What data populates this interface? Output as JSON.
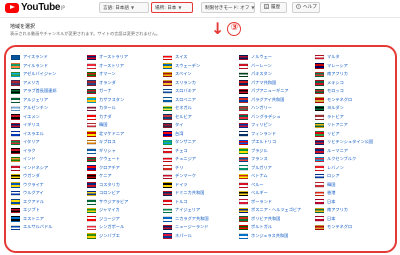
{
  "header": {
    "logo_text": "YouTube",
    "logo_suffix": "JP",
    "language_label": "言語: 日本語",
    "location_label": "場所: 日本",
    "restricted_label": "制限付きモード: オフ",
    "history_label": "履歴",
    "help_label": "ヘルプ"
  },
  "page": {
    "heading": "地域を選択",
    "subtext": "表示される動画やチャンネルが変更されます。サイトの言語は変更されません。",
    "annotation_number": "③",
    "accent_color": "#e53935"
  },
  "columns": [
    [
      {
        "name": "アイスランド",
        "c": [
          "#02529c",
          "#02529c"
        ]
      },
      {
        "name": "アイルランド",
        "c": [
          "#169b62",
          "#ff883e"
        ]
      },
      {
        "name": "アゼルバイジャン",
        "c": [
          "#00b5e2",
          "#3f9c35"
        ]
      },
      {
        "name": "アメリカ",
        "c": [
          "#b22234",
          "#3c3b6e"
        ]
      },
      {
        "name": "アラブ首長国連邦",
        "c": [
          "#00732f",
          "#000000"
        ]
      },
      {
        "name": "アルジェリア",
        "c": [
          "#006233",
          "#ffffff"
        ]
      },
      {
        "name": "アルゼンチン",
        "c": [
          "#74acdf",
          "#ffffff"
        ]
      },
      {
        "name": "イエメン",
        "c": [
          "#ce1126",
          "#000000"
        ]
      },
      {
        "name": "イギリス",
        "c": [
          "#012169",
          "#c8102e"
        ]
      },
      {
        "name": "イスラエル",
        "c": [
          "#ffffff",
          "#0038b8"
        ]
      },
      {
        "name": "イタリア",
        "c": [
          "#009246",
          "#ce2b37"
        ]
      },
      {
        "name": "イラク",
        "c": [
          "#ce1126",
          "#000000"
        ]
      },
      {
        "name": "インド",
        "c": [
          "#ff9933",
          "#138808"
        ]
      },
      {
        "name": "インドネシア",
        "c": [
          "#ce1126",
          "#ffffff"
        ]
      },
      {
        "name": "ウガンダ",
        "c": [
          "#000000",
          "#fcdc04"
        ]
      },
      {
        "name": "ウクライナ",
        "c": [
          "#0057b7",
          "#ffd700"
        ]
      },
      {
        "name": "ウルグアイ",
        "c": [
          "#ffffff",
          "#0038a8"
        ]
      },
      {
        "name": "エクアドル",
        "c": [
          "#ffdd00",
          "#034ea2"
        ]
      },
      {
        "name": "エジプト",
        "c": [
          "#ce1126",
          "#000000"
        ]
      },
      {
        "name": "エストニア",
        "c": [
          "#0072ce",
          "#000000"
        ]
      },
      {
        "name": "エルサルバドル",
        "c": [
          "#0047ab",
          "#ffffff"
        ]
      }
    ],
    [
      {
        "name": "オーストラリア",
        "c": [
          "#012169",
          "#e4002b"
        ]
      },
      {
        "name": "オーストリア",
        "c": [
          "#ed2939",
          "#ffffff"
        ]
      },
      {
        "name": "オマーン",
        "c": [
          "#db161b",
          "#008000"
        ]
      },
      {
        "name": "オランダ",
        "c": [
          "#ae1c28",
          "#21468b"
        ]
      },
      {
        "name": "ガーナ",
        "c": [
          "#ce1126",
          "#006b3f"
        ]
      },
      {
        "name": "カザフスタン",
        "c": [
          "#00afca",
          "#fec50c"
        ]
      },
      {
        "name": "カタール",
        "c": [
          "#8a1538",
          "#ffffff"
        ]
      },
      {
        "name": "カナダ",
        "c": [
          "#ff0000",
          "#ffffff"
        ]
      },
      {
        "name": "韓国",
        "c": [
          "#ffffff",
          "#cd2e3a"
        ]
      },
      {
        "name": "北マケドニア",
        "c": [
          "#d20000",
          "#ffe600"
        ]
      },
      {
        "name": "キプロス",
        "c": [
          "#ffffff",
          "#d57800"
        ]
      },
      {
        "name": "ギリシャ",
        "c": [
          "#0d5eaf",
          "#ffffff"
        ]
      },
      {
        "name": "クウェート",
        "c": [
          "#007a3d",
          "#ce1126"
        ]
      },
      {
        "name": "クロアチア",
        "c": [
          "#ff0000",
          "#171796"
        ]
      },
      {
        "name": "ケニア",
        "c": [
          "#000000",
          "#bb0000"
        ]
      },
      {
        "name": "コスタリカ",
        "c": [
          "#002b7f",
          "#ce1126"
        ]
      },
      {
        "name": "コロンビア",
        "c": [
          "#fcd116",
          "#003893"
        ]
      },
      {
        "name": "サウジアラビア",
        "c": [
          "#006c35",
          "#ffffff"
        ]
      },
      {
        "name": "ジャマイカ",
        "c": [
          "#009b3a",
          "#fed100"
        ]
      },
      {
        "name": "ジョージア",
        "c": [
          "#ffffff",
          "#ff0000"
        ]
      },
      {
        "name": "シンガポール",
        "c": [
          "#ef3340",
          "#ffffff"
        ]
      },
      {
        "name": "ジンバブエ",
        "c": [
          "#319208",
          "#ffd200"
        ]
      }
    ],
    [
      {
        "name": "スイス",
        "c": [
          "#ff0000",
          "#ffffff"
        ]
      },
      {
        "name": "スウェーデン",
        "c": [
          "#006aa7",
          "#fecc00"
        ]
      },
      {
        "name": "スペイン",
        "c": [
          "#aa151b",
          "#f1bf00"
        ]
      },
      {
        "name": "スリランカ",
        "c": [
          "#8d153a",
          "#ffbe29"
        ]
      },
      {
        "name": "スロバキア",
        "c": [
          "#ffffff",
          "#0b4ea2"
        ]
      },
      {
        "name": "スロベニア",
        "c": [
          "#ffffff",
          "#005da4"
        ]
      },
      {
        "name": "セネガル",
        "c": [
          "#00853f",
          "#fdef42"
        ]
      },
      {
        "name": "セルビア",
        "c": [
          "#c6363c",
          "#0c4076"
        ]
      },
      {
        "name": "タイ",
        "c": [
          "#a51931",
          "#2d2a4a"
        ]
      },
      {
        "name": "台湾",
        "c": [
          "#fe0000",
          "#000095"
        ]
      },
      {
        "name": "タンザニア",
        "c": [
          "#1eb53a",
          "#00a3dd"
        ]
      },
      {
        "name": "チェコ",
        "c": [
          "#ffffff",
          "#d7141a"
        ]
      },
      {
        "name": "チュニジア",
        "c": [
          "#e70013",
          "#ffffff"
        ]
      },
      {
        "name": "チリ",
        "c": [
          "#ffffff",
          "#d52b1e"
        ]
      },
      {
        "name": "デンマーク",
        "c": [
          "#c8102e",
          "#ffffff"
        ]
      },
      {
        "name": "ドイツ",
        "c": [
          "#000000",
          "#ffce00"
        ]
      },
      {
        "name": "ドミニカ共和国",
        "c": [
          "#002d62",
          "#ce1126"
        ]
      },
      {
        "name": "トルコ",
        "c": [
          "#e30a17",
          "#ffffff"
        ]
      },
      {
        "name": "ナイジェリア",
        "c": [
          "#008751",
          "#ffffff"
        ]
      },
      {
        "name": "ニカラグア共和国",
        "c": [
          "#0067c6",
          "#ffffff"
        ]
      },
      {
        "name": "ニュージーランド",
        "c": [
          "#012169",
          "#c8102e"
        ]
      },
      {
        "name": "ネパール",
        "c": [
          "#dc143c",
          "#003893"
        ]
      }
    ],
    [
      {
        "name": "ノルウェー",
        "c": [
          "#ba0c2f",
          "#00205b"
        ]
      },
      {
        "name": "バーレーン",
        "c": [
          "#ce1126",
          "#ffffff"
        ]
      },
      {
        "name": "パキスタン",
        "c": [
          "#01411c",
          "#ffffff"
        ]
      },
      {
        "name": "パナマ共和国",
        "c": [
          "#da121a",
          "#072357"
        ]
      },
      {
        "name": "パプアニューギニア",
        "c": [
          "#000000",
          "#ce1126"
        ]
      },
      {
        "name": "パラグアイ共和国",
        "c": [
          "#d52b1e",
          "#0038a8"
        ]
      },
      {
        "name": "ハンガリー",
        "c": [
          "#ce2939",
          "#477050"
        ]
      },
      {
        "name": "バングラデシュ",
        "c": [
          "#006a4e",
          "#f42a41"
        ]
      },
      {
        "name": "フィリピン",
        "c": [
          "#0038a8",
          "#ce1126"
        ]
      },
      {
        "name": "フィンランド",
        "c": [
          "#ffffff",
          "#002f6c"
        ]
      },
      {
        "name": "プエルトリコ",
        "c": [
          "#ed0000",
          "#0050f0"
        ]
      },
      {
        "name": "ブラジル",
        "c": [
          "#009c3b",
          "#ffdf00"
        ]
      },
      {
        "name": "フランス",
        "c": [
          "#0055a4",
          "#ef4135"
        ]
      },
      {
        "name": "ブルガリア",
        "c": [
          "#ffffff",
          "#00966e"
        ]
      },
      {
        "name": "ベトナム",
        "c": [
          "#da251d",
          "#ffff00"
        ]
      },
      {
        "name": "ペルー",
        "c": [
          "#d91023",
          "#ffffff"
        ]
      },
      {
        "name": "ベルギー",
        "c": [
          "#000000",
          "#fdda24"
        ]
      },
      {
        "name": "ポーランド",
        "c": [
          "#ffffff",
          "#dc143c"
        ]
      },
      {
        "name": "ボスニア・ヘルツェゴビナ",
        "c": [
          "#002395",
          "#fecb00"
        ]
      },
      {
        "name": "ボリビア共和国",
        "c": [
          "#d52b1e",
          "#007934"
        ]
      },
      {
        "name": "ポルトガル",
        "c": [
          "#006600",
          "#ff0000"
        ]
      },
      {
        "name": "ホンジュラス共和国",
        "c": [
          "#0073cf",
          "#ffffff"
        ]
      }
    ],
    [
      {
        "name": "マルタ",
        "c": [
          "#ffffff",
          "#cf142b"
        ]
      },
      {
        "name": "マレーシア",
        "c": [
          "#cc0001",
          "#010066"
        ]
      },
      {
        "name": "南アフリカ",
        "c": [
          "#007a4d",
          "#de3831"
        ]
      },
      {
        "name": "メキシコ",
        "c": [
          "#006847",
          "#ce1126"
        ]
      },
      {
        "name": "モロッコ",
        "c": [
          "#c1272d",
          "#006233"
        ]
      },
      {
        "name": "モンテネグロ",
        "c": [
          "#c40308",
          "#d4af3a"
        ]
      },
      {
        "name": "ヨルダン",
        "c": [
          "#000000",
          "#007a3d"
        ]
      },
      {
        "name": "ラトビア",
        "c": [
          "#9e3039",
          "#ffffff"
        ]
      },
      {
        "name": "リトアニア",
        "c": [
          "#fdb913",
          "#006a44"
        ]
      },
      {
        "name": "リビア",
        "c": [
          "#e70013",
          "#239e46"
        ]
      },
      {
        "name": "リヒテンシュタイン公国",
        "c": [
          "#002b7f",
          "#ce1126"
        ]
      },
      {
        "name": "ルーマニア",
        "c": [
          "#002b7f",
          "#ce1126"
        ]
      },
      {
        "name": "ルクセンブルク",
        "c": [
          "#ed2939",
          "#00a1de"
        ]
      },
      {
        "name": "レバノン",
        "c": [
          "#ed1c24",
          "#ffffff"
        ]
      },
      {
        "name": "ロシア",
        "c": [
          "#ffffff",
          "#0039a6"
        ]
      },
      {
        "name": "韓国",
        "c": [
          "#ffffff",
          "#cd2e3a"
        ]
      },
      {
        "name": "香港",
        "c": [
          "#de2910",
          "#ffffff"
        ]
      },
      {
        "name": "日本",
        "c": [
          "#ffffff",
          "#bc002d"
        ]
      },
      {
        "name": "南アフリカ",
        "c": [
          "#007a4d",
          "#ffb612"
        ]
      },
      {
        "name": "日本",
        "c": [
          "#ffffff",
          "#bc002d"
        ]
      },
      {
        "name": "モンテネグロ",
        "c": [
          "#c40308",
          "#d4af3a"
        ]
      }
    ]
  ]
}
